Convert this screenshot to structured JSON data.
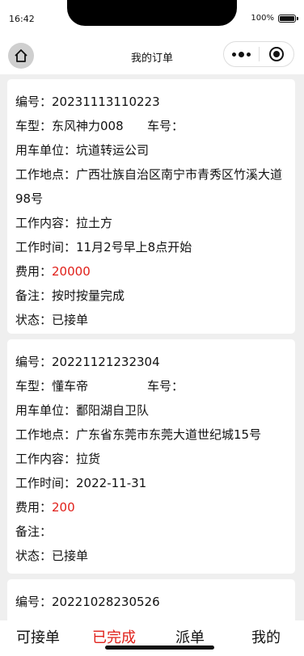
{
  "status": {
    "time": "16:42",
    "battery": "100%"
  },
  "nav": {
    "title": "我的订单"
  },
  "labels": {
    "id": "编号：",
    "car_type": "车型：",
    "plate": "车号：",
    "unit": "用车单位：",
    "location": "工作地点：",
    "content": "工作内容：",
    "time": "工作时间：",
    "fee": "费用：",
    "remark": "备注：",
    "state": "状态："
  },
  "orders": [
    {
      "id": "20231113110223",
      "car_type": "东风神力008",
      "plate": "",
      "unit": "坑道转运公司",
      "location": "广西壮族自治区南宁市青秀区竹溪大道98号",
      "content": "拉土方",
      "time": "11月2号早上8点开始",
      "fee": "20000",
      "remark": "按时按量完成",
      "state": "已接单"
    },
    {
      "id": "20221121232304",
      "car_type": "懂车帝",
      "plate": "",
      "unit": "鄱阳湖自卫队",
      "location": "广东省东莞市东莞大道世纪城15号",
      "content": "拉货",
      "time": "2022-11-31",
      "fee": "200",
      "remark": "",
      "state": "已接单"
    },
    {
      "id": "20221028230526"
    }
  ],
  "tabs": [
    {
      "label": "可接单",
      "active": false
    },
    {
      "label": "已完成",
      "active": true
    },
    {
      "label": "派单",
      "active": false
    },
    {
      "label": "我的",
      "active": false
    }
  ],
  "colors": {
    "accent": "#e0201a",
    "background": "#efefef"
  },
  "icons": {
    "home": "home-icon",
    "more": "more-dots-icon",
    "close": "target-icon"
  }
}
